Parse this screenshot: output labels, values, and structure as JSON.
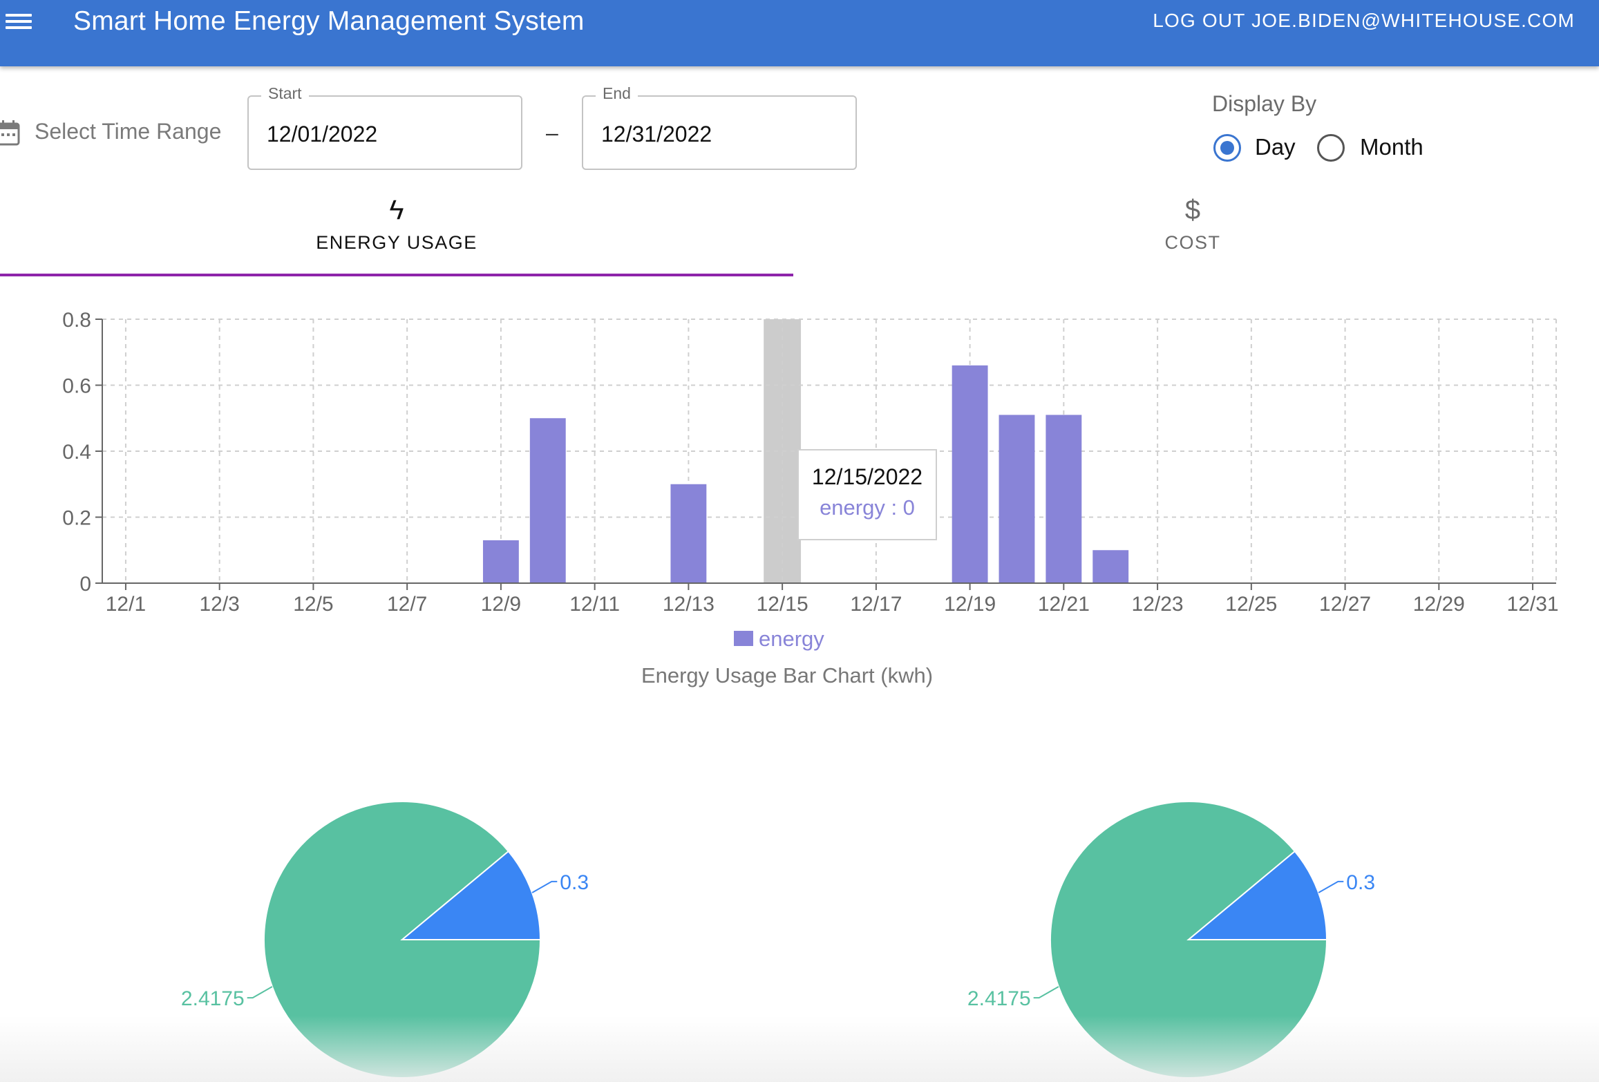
{
  "header": {
    "title": "Smart Home Energy Management System",
    "logout_label": "LOG OUT JOE.BIDEN@WHITEHOUSE.COM",
    "icons": {
      "menu": "menu-icon"
    }
  },
  "filters": {
    "range_label": "Select Time Range",
    "start": {
      "label": "Start",
      "value": "12/01/2022"
    },
    "separator": "–",
    "end": {
      "label": "End",
      "value": "12/31/2022"
    },
    "display_by": {
      "label": "Display By",
      "options": [
        {
          "label": "Day",
          "selected": true
        },
        {
          "label": "Month",
          "selected": false
        }
      ]
    },
    "icons": {
      "calendar": "calendar-icon"
    }
  },
  "tabs": [
    {
      "label": "ENERGY USAGE",
      "icon": "lightning-bolt-icon",
      "glyph": "ϟ",
      "active": true
    },
    {
      "label": "COST",
      "icon": "dollar-icon",
      "glyph": "$",
      "active": false
    }
  ],
  "tooltip": {
    "date": "12/15/2022",
    "text": "energy : 0"
  },
  "colors": {
    "appbar": "#3a75d0",
    "bar": "#8884d8",
    "highlight": "#cccccc",
    "tab_indicator": "#8e24aa",
    "pie_large": "#58c1a1",
    "pie_small": "#3a86f4"
  },
  "chart_data": [
    {
      "type": "bar",
      "title": "Energy Usage Bar Chart (kwh)",
      "xlabel": "",
      "ylabel": "",
      "ylim": [
        0,
        0.8
      ],
      "yticks": [
        "0",
        "0.2",
        "0.4",
        "0.6",
        "0.8"
      ],
      "grid": true,
      "legend": "bottom",
      "tick_labels": [
        "12/1",
        "12/3",
        "12/5",
        "12/7",
        "12/9",
        "12/11",
        "12/13",
        "12/15",
        "12/17",
        "12/19",
        "12/21",
        "12/23",
        "12/25",
        "12/27",
        "12/29",
        "12/31"
      ],
      "categories": [
        "12/1",
        "12/2",
        "12/3",
        "12/4",
        "12/5",
        "12/6",
        "12/7",
        "12/8",
        "12/9",
        "12/10",
        "12/11",
        "12/12",
        "12/13",
        "12/14",
        "12/15",
        "12/16",
        "12/17",
        "12/18",
        "12/19",
        "12/20",
        "12/21",
        "12/22",
        "12/23",
        "12/24",
        "12/25",
        "12/26",
        "12/27",
        "12/28",
        "12/29",
        "12/30",
        "12/31"
      ],
      "series": [
        {
          "name": "energy",
          "values": [
            0,
            0,
            0,
            0,
            0,
            0,
            0,
            0,
            0.13,
            0.5,
            0,
            0,
            0.3,
            0,
            0,
            0,
            0,
            0,
            0.66,
            0.51,
            0.51,
            0.1,
            0,
            0,
            0,
            0,
            0,
            0,
            0,
            0,
            0
          ]
        }
      ],
      "highlighted_category": "12/15"
    },
    {
      "type": "pie",
      "labels": [
        "2.4175",
        "0.3"
      ],
      "values": [
        2.4175,
        0.3
      ],
      "colors": [
        "#58c1a1",
        "#3a86f4"
      ]
    },
    {
      "type": "pie",
      "labels": [
        "2.4175",
        "0.3"
      ],
      "values": [
        2.4175,
        0.3
      ],
      "colors": [
        "#58c1a1",
        "#3a86f4"
      ]
    }
  ]
}
